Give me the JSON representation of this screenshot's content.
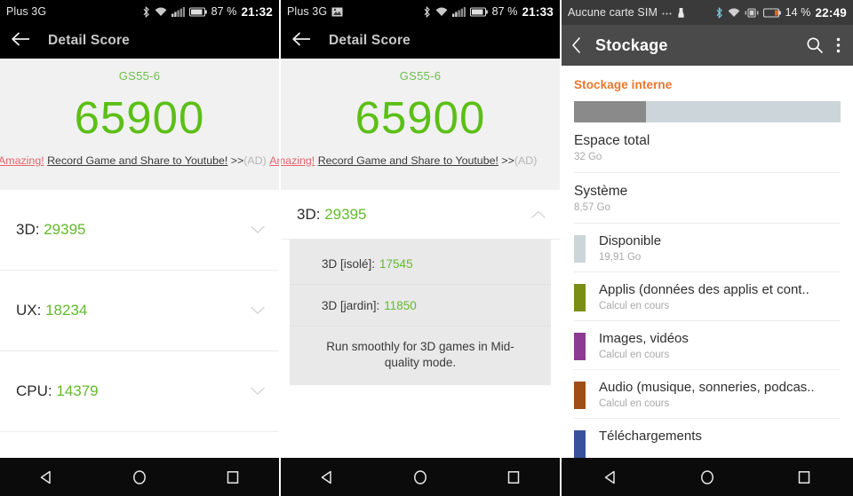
{
  "panels": {
    "left": {
      "statusbar": {
        "carrier": "Plus 3G",
        "battery_pct": "87 %",
        "time": "21:32",
        "icons": [
          "bluetooth-icon",
          "wifi-icon",
          "signal-icon",
          "battery-icon"
        ]
      },
      "appbar": {
        "title": "Detail Score",
        "back": "back-arrow-icon"
      },
      "score": {
        "device": "GS55-6",
        "total": "65900",
        "ad": {
          "highlight": "Amazing!",
          "body": "Record Game and Share to Youtube!",
          "arrows": ">>",
          "tag": "(AD)",
          "repeat_highlight": "Amazing!"
        }
      },
      "rows": [
        {
          "label": "3D:",
          "value": "29395",
          "state": "collapsed"
        },
        {
          "label": "UX:",
          "value": "18234",
          "state": "collapsed"
        },
        {
          "label": "CPU:",
          "value": "14379",
          "state": "collapsed"
        }
      ]
    },
    "middle": {
      "statusbar": {
        "carrier": "Plus 3G",
        "battery_pct": "87 %",
        "time": "21:33",
        "icons": [
          "screenshot-icon",
          "bluetooth-icon",
          "wifi-icon",
          "signal-icon",
          "battery-icon"
        ]
      },
      "appbar": {
        "title": "Detail Score",
        "back": "back-arrow-icon"
      },
      "score": {
        "device": "GS55-6",
        "total": "65900",
        "ad": {
          "highlight": "Amazing!",
          "body": "Record Game and Share to Youtube!",
          "arrows": ">>",
          "tag": "(AD)",
          "repeat_highlight": "Amazing!"
        }
      },
      "row_expanded": {
        "label": "3D:",
        "value": "29395",
        "state": "expanded"
      },
      "sub_rows": [
        {
          "label": "3D [isolé]:",
          "value": "17545"
        },
        {
          "label": "3D [jardin]:",
          "value": "11850"
        }
      ],
      "sub_note": "Run smoothly for 3D games in Mid-quality mode."
    },
    "right": {
      "statusbar": {
        "carrier": "Aucune carte SIM",
        "battery_pct": "14 %",
        "time": "22:49",
        "icons": [
          "more-dots-icon",
          "sim-icon",
          "bluetooth-icon",
          "wifi-icon",
          "vibrate-icon",
          "battery-icon"
        ]
      },
      "appbar": {
        "title": "Stockage",
        "back": "back-chevron-icon",
        "search": "search-icon",
        "overflow": "overflow-menu-icon"
      },
      "section_title": "Stockage interne",
      "usage_bar": {
        "used_percent": 27,
        "used_color": "#8a8a8a",
        "free_color": "#ccd6da"
      },
      "items": [
        {
          "title": "Espace total",
          "sub": "32 Go"
        },
        {
          "title": "Système",
          "sub": "8,57 Go"
        }
      ],
      "categories": [
        {
          "title": "Disponible",
          "sub": "19,91 Go",
          "color": "#ccd6da"
        },
        {
          "title": "Applis (données des applis et cont..",
          "sub": "Calcul en cours",
          "color": "#7a8e14"
        },
        {
          "title": "Images, vidéos",
          "sub": "Calcul en cours",
          "color": "#8c3a92"
        },
        {
          "title": "Audio (musique, sonneries, podcas..",
          "sub": "Calcul en cours",
          "color": "#9e4f18"
        },
        {
          "title": "Téléchargements",
          "sub": "",
          "color": "#37529b"
        }
      ]
    }
  },
  "navbar": {
    "back": "nav-back-triangle-icon",
    "home": "nav-home-circle-icon",
    "recents": "nav-recents-square-icon"
  },
  "colors": {
    "score_green": "#5cbf16",
    "row_green": "#62bb2a",
    "ad_red": "#e8636b",
    "storage_accent": "#e8762a",
    "appbar_dark": "#4a4a4a"
  }
}
